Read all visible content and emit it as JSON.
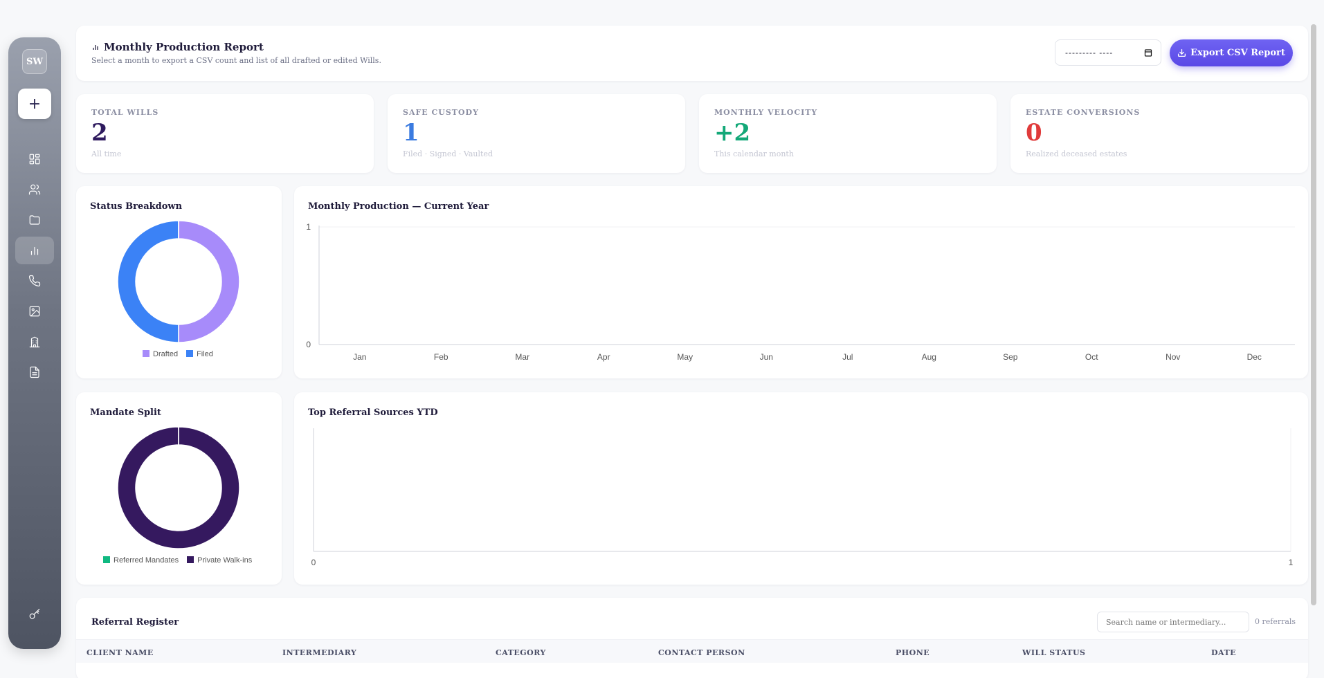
{
  "sidebar": {
    "avatar": "SW",
    "add_label": "+",
    "items": [
      {
        "icon": "dashboard-icon"
      },
      {
        "icon": "users-icon"
      },
      {
        "icon": "folder-icon"
      },
      {
        "icon": "bar-chart-icon",
        "active": true
      },
      {
        "icon": "phone-icon"
      },
      {
        "icon": "image-icon"
      },
      {
        "icon": "building-icon"
      },
      {
        "icon": "document-icon"
      }
    ],
    "bottom_icon": "key-icon"
  },
  "header": {
    "title": "Monthly Production Report",
    "subtitle": "Select a month to export a CSV count and list of all drafted or edited Wills.",
    "month_placeholder": "--------- ----",
    "export_label": "Export CSV Report"
  },
  "stats": [
    {
      "label": "TOTAL WILLS",
      "value": "2",
      "sub": "All time",
      "color": "#2e1a5e"
    },
    {
      "label": "SAFE CUSTODY",
      "value": "1",
      "sub": "Filed · Signed · Vaulted",
      "color": "#3b7be0"
    },
    {
      "label": "MONTHLY VELOCITY",
      "value": "+2",
      "sub": "This calendar month",
      "color": "#13a878"
    },
    {
      "label": "ESTATE CONVERSIONS",
      "value": "0",
      "sub": "Realized deceased estates",
      "color": "#e03b3b"
    }
  ],
  "status_breakdown": {
    "title": "Status Breakdown",
    "legend": [
      "Drafted",
      "Filed"
    ]
  },
  "mandate_split": {
    "title": "Mandate Split",
    "legend": [
      "Referred Mandates",
      "Private Walk-ins"
    ]
  },
  "monthly_production": {
    "title": "Monthly Production — Current Year"
  },
  "top_referrals": {
    "title": "Top Referral Sources YTD"
  },
  "chart_data": [
    {
      "type": "pie",
      "title": "Status Breakdown",
      "categories": [
        "Drafted",
        "Filed"
      ],
      "values": [
        1,
        1
      ],
      "colors": [
        "#a78bfa",
        "#3b82f6"
      ],
      "legend": "bottom"
    },
    {
      "type": "bar",
      "title": "Monthly Production — Current Year",
      "categories": [
        "Jan",
        "Feb",
        "Mar",
        "Apr",
        "May",
        "Jun",
        "Jul",
        "Aug",
        "Sep",
        "Oct",
        "Nov",
        "Dec"
      ],
      "values": [
        0,
        0,
        0,
        0,
        0,
        0,
        0,
        0,
        0,
        0,
        0,
        0
      ],
      "ylim": [
        0,
        1
      ],
      "yticks": [
        "0",
        "1"
      ]
    },
    {
      "type": "pie",
      "title": "Mandate Split",
      "categories": [
        "Referred Mandates",
        "Private Walk-ins"
      ],
      "values": [
        0,
        2
      ],
      "colors": [
        "#10b981",
        "#35195f"
      ],
      "legend": "bottom"
    },
    {
      "type": "bar",
      "title": "Top Referral Sources YTD",
      "categories": [],
      "values": [],
      "xlim": [
        0,
        1
      ],
      "xticks": [
        "0",
        "1"
      ]
    }
  ],
  "register": {
    "title": "Referral Register",
    "search_placeholder": "Search name or intermediary...",
    "count_text": "0 referrals",
    "columns": [
      "CLIENT NAME",
      "INTERMEDIARY",
      "CATEGORY",
      "CONTACT PERSON",
      "PHONE",
      "WILL STATUS",
      "DATE"
    ]
  }
}
